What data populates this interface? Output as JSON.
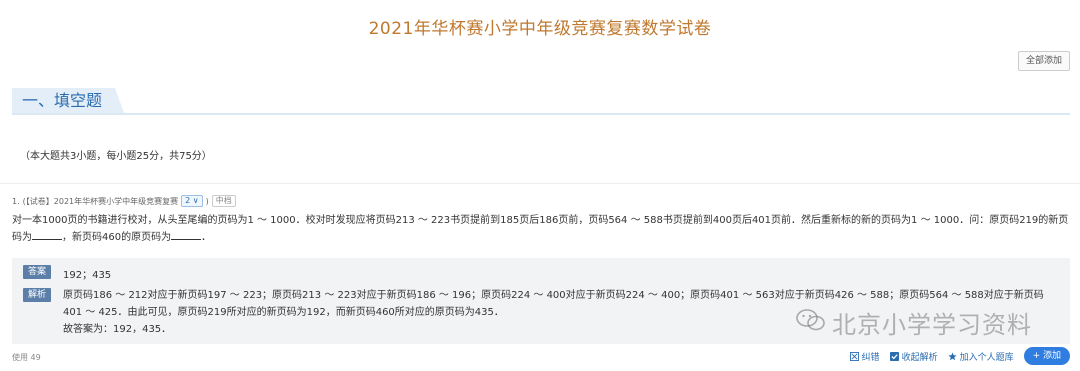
{
  "exam": {
    "title": "2021年华杯赛小学中年级竞赛复赛数学试卷",
    "add_all_label": "全部添加"
  },
  "section": {
    "heading": "一、填空题",
    "description": "（本大题共3小题，每小题25分，共75分）"
  },
  "question": {
    "number": "1.",
    "source_prefix": "(【试卷】2021年华杯赛小学中年级竞赛复赛",
    "select_value": "2",
    "source_suffix": ")",
    "difficulty": "中档",
    "text_part1": "对一本1000页的书籍进行校对，从头至尾编的页码为1 ～ 1000．校对时发现应将页码213 ～ 223书页提前到185页后186页前，页码564 ～ 588书页提前到400页后401页前．然后重新标的新的页码为1 ～ 1000．问：原页码219的新页码为",
    "text_part2": "，新页码460的原页码为",
    "text_part3": "．"
  },
  "answer": {
    "answer_label": "答案",
    "answer_value": "192；435",
    "explain_label": "解析",
    "explain_line1": "原页码186 ～ 212对应于新页码197 ～ 223；原页码213 ～ 223对应于新页码186 ～ 196；原页码224 ～ 400对应于新页码224 ～ 400；原页码401 ～ 563对应于新页码426 ～ 588；原页码564 ～ 588对应于新页码401 ～ 425．由此可见，原页码219所对应的新页码为192，而新页码460所对应的原页码为435．",
    "explain_line2": "故答案为：192，435．"
  },
  "footer": {
    "usage": "使用 49",
    "correct_label": "纠错",
    "collapse_label": "收起解析",
    "add_personal_label": "加入个人题库",
    "add_label": "+ 添加"
  },
  "watermark": {
    "text": "北京小学学习资料"
  },
  "colors": {
    "title": "#c0782e",
    "accent": "#2b6cb0",
    "badge": "#5b7fa8",
    "add_button": "#2f7de1"
  },
  "icons": [
    "correct-icon",
    "check-icon",
    "star-icon",
    "wechat-icon"
  ]
}
